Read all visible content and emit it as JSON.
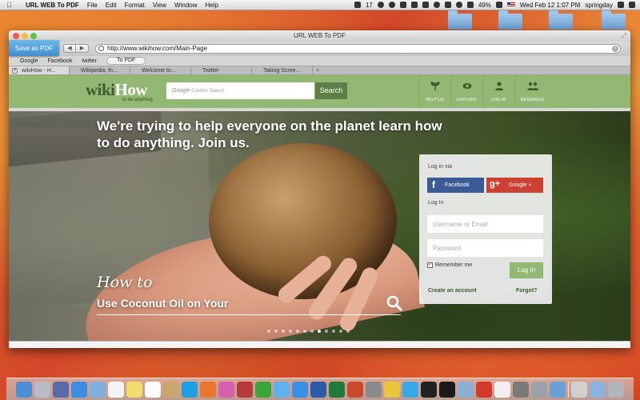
{
  "menubar": {
    "app_name": "URL WEB To PDF",
    "menus": [
      "File",
      "Edit",
      "Format",
      "View",
      "Window",
      "Help"
    ],
    "badge_count": "17",
    "battery": "49%",
    "datetime": "Wed Feb 12  1:07 PM",
    "user": "springday"
  },
  "window": {
    "title": "URL WEB To PDF",
    "save_pdf_label": "Save as PDF",
    "back_glyph": "◀",
    "forward_glyph": "▶",
    "url": "http://www.wikihow.com/Main-Page",
    "bookmarks": [
      "Google",
      "Facebook",
      "twitter"
    ],
    "to_pdf_label": "To PDF",
    "tabs": [
      "wikiHow - H...",
      "Wikipedia, th...",
      "Welcome to...",
      "Twitter",
      "Taking Scree..."
    ],
    "add_tab_glyph": "+"
  },
  "wikihow": {
    "logo_wiki": "wiki",
    "logo_how": "How",
    "logo_tagline": "to do anything",
    "search_brand": "Google",
    "search_placeholder": "Custom Search",
    "search_button": "Search",
    "nav": [
      {
        "label": "HELP US",
        "icon": "sprout-icon"
      },
      {
        "label": "EXPLORE",
        "icon": "eye-icon"
      },
      {
        "label": "LOG IN",
        "icon": "user-icon"
      },
      {
        "label": "MESSAGES",
        "icon": "people-icon"
      }
    ],
    "headline": "We're trying to help everyone on the planet learn how to do anything. Join us.",
    "howto_script": "How to",
    "howto_title": "Use Coconut Oil on Your",
    "slide_count": 12,
    "active_slide": 7
  },
  "login": {
    "login_via": "Log in via",
    "facebook": "Facebook",
    "facebook_glyph": "f",
    "google": "Google +",
    "google_glyph": "g+",
    "login_heading": "Log In",
    "username_placeholder": "Username or Email",
    "password_placeholder": "Password",
    "remember_me": "Remember me",
    "remember_checked": true,
    "login_button": "Log In",
    "create_account": "Create an account",
    "forgot": "Forgot?"
  },
  "colors": {
    "wikihow_green": "#93b874",
    "wikihow_dark": "#5d7f45",
    "facebook_blue": "#3b5b96",
    "google_red": "#cc4133",
    "save_pdf_blue": "#3f8fd0"
  },
  "dock": {
    "icons": [
      "finder-icon",
      "launchpad-icon",
      "mission-control-icon",
      "safari-icon",
      "mail-icon",
      "calendar-icon",
      "notes-icon",
      "reminders-icon",
      "contacts-icon",
      "skype-icon",
      "firefox-icon",
      "itunes-icon",
      "photo-booth-icon",
      "facetime-icon",
      "messages-icon",
      "app-store-icon",
      "word-icon",
      "excel-icon",
      "powerpoint-icon",
      "system-prefs-icon",
      "chrome-icon",
      "twitter-icon",
      "qq-icon",
      "terminal-icon",
      "preview-icon",
      "pdf-icon",
      "textedit-icon",
      "activity-icon",
      "hd-icon",
      "download-icon",
      "documents-icon",
      "folder-icon",
      "trash-icon"
    ],
    "colors": [
      "#4b8fd6",
      "#b7bcc7",
      "#5a6aa8",
      "#3c8ee0",
      "#7fb0e0",
      "#f4f4f4",
      "#f2dc6b",
      "#fbfbfb",
      "#c9a66b",
      "#1ca0e3",
      "#e8762c",
      "#d75fb0",
      "#b83a3a",
      "#3aa63a",
      "#5fb2f0",
      "#3a8fe6",
      "#2b5aa8",
      "#1e7a3a",
      "#c94a2a",
      "#8a8a8a",
      "#e8c53a",
      "#38a9e8",
      "#222222",
      "#1a1a1a",
      "#8ab0d6",
      "#d43a2a",
      "#f0f0f0",
      "#7a7a7a",
      "#9aa2aa",
      "#6aa0d6",
      "#d0d0d0",
      "#89b4e0",
      "#b0b6bc"
    ]
  }
}
